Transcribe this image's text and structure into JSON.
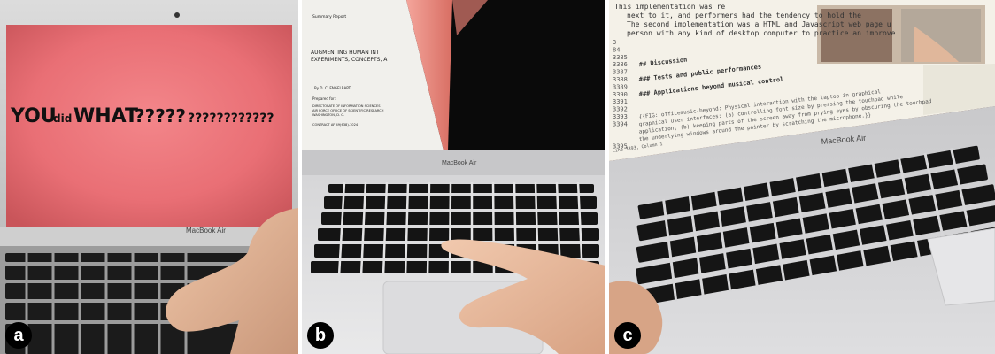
{
  "panels": [
    {
      "label": "a",
      "screen_text": {
        "you": "YOU",
        "did": "did",
        "what": "WHAT",
        "marks": "?????",
        "small_marks": "????????????"
      },
      "brand": "MacBook Air"
    },
    {
      "label": "b",
      "brand": "MacBook Air",
      "document": {
        "header": "Summary Report",
        "title_line1": "AUGMENTING HUMAN INT",
        "title_line2": "EXPERIMENTS, CONCEPTS, A",
        "author": "By  D. C. ENGELBART",
        "prepared_for": "Prepared for:",
        "org1": "DIRECTORATE OF INFORMATION SCIENCES",
        "org2": "AIR FORCE OFFICE OF SCIENTIFIC RESEARCH",
        "org3": "WASHINGTON, D. C.",
        "contract": "CONTRACT AF 49(638)-1024"
      }
    },
    {
      "label": "c",
      "brand": "MacBook Air",
      "editor": {
        "top_line1": "This implementation was re",
        "top_line2": "next to it, and performers had the tendency to hold the",
        "top_line3": "The second implementation was a HTML and Javascript web page u",
        "top_line4": "person with any kind of desktop computer to practice an improve",
        "lines": [
          {
            "num": "3",
            "text": ""
          },
          {
            "num": "84",
            "text": ""
          },
          {
            "num": "3385",
            "text": ""
          },
          {
            "num": "3386",
            "text": "## Discussion"
          },
          {
            "num": "3387",
            "text": ""
          },
          {
            "num": "3388",
            "text": "### Tests and public performances"
          },
          {
            "num": "3389",
            "text": ""
          },
          {
            "num": "3390",
            "text": "### Applications beyond musical control"
          },
          {
            "num": "3391",
            "text": ""
          },
          {
            "num": "3392",
            "text": ""
          },
          {
            "num": "3393",
            "text": "{{FIG: officemusic-beyond: Physical interaction with the laptop in graphical"
          },
          {
            "num": "3394",
            "text": "graphical user interfaces: (a) controlling font size by pressing the touchpad while"
          },
          {
            "num": "",
            "text": "application; (b) keeping parts of the screen away from prying eyes by obscuring the touchpad"
          },
          {
            "num": "",
            "text": "the underlying windows around the pointer by scratching the microphone.}}"
          },
          {
            "num": "3395",
            "text": ""
          }
        ],
        "status": "Line 3393, Column 1"
      }
    }
  ]
}
